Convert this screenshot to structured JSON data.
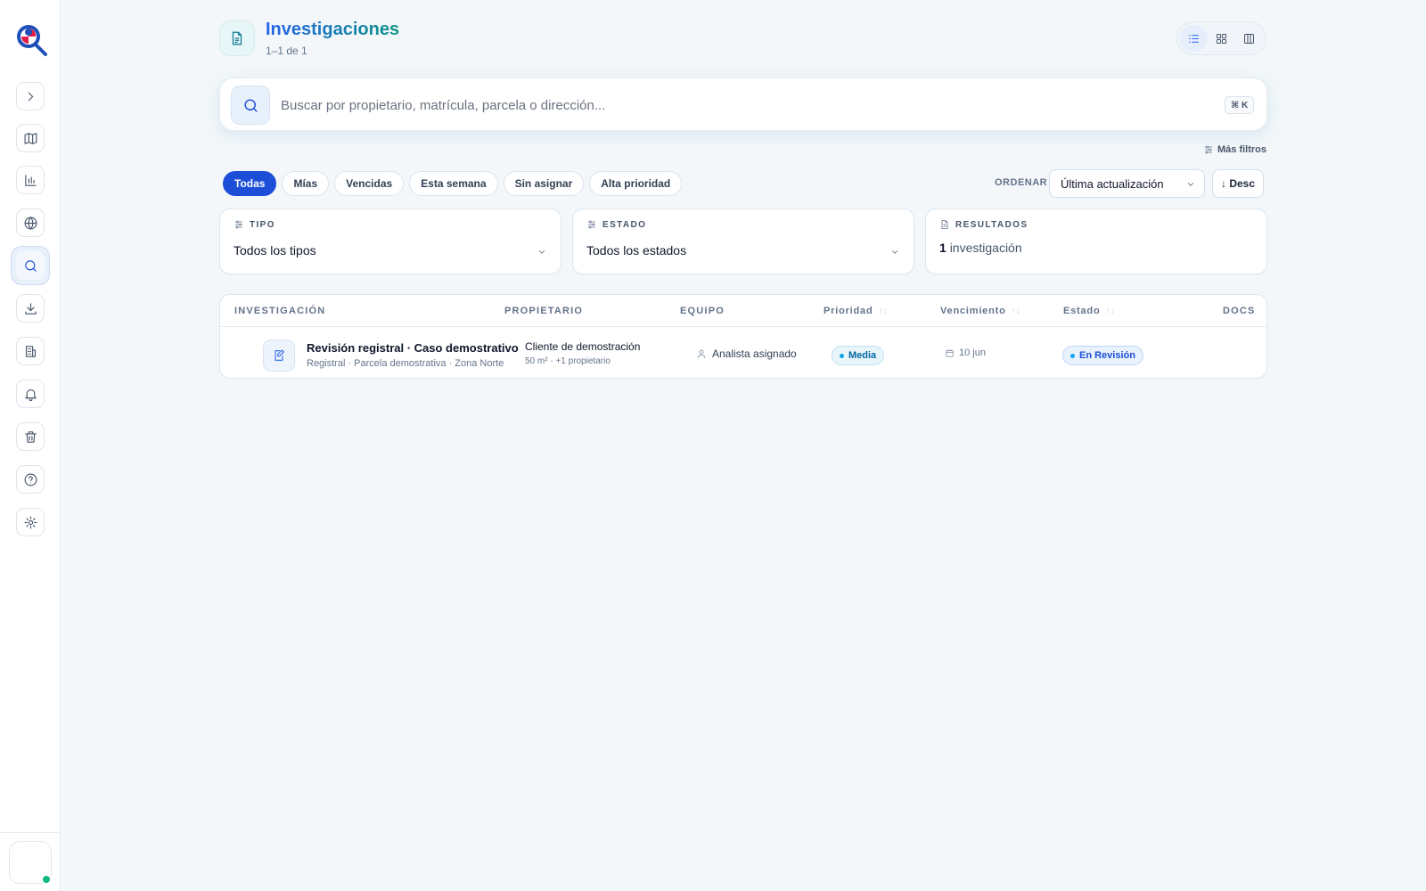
{
  "header": {
    "title": "Investigaciones",
    "range": "1–1 de 1"
  },
  "search": {
    "placeholder": "Buscar por propietario, matrícula, parcela o dirección...",
    "shortcut": "⌘ K"
  },
  "filters": {
    "more_label": "Más filtros",
    "chips": [
      "Todas",
      "Mías",
      "Vencidas",
      "Esta semana",
      "Sin asignar",
      "Alta prioridad"
    ],
    "active_chip": "Todas"
  },
  "sort": {
    "label": "ORDENAR",
    "selected": "Última actualización",
    "direction": "↓ Desc"
  },
  "cards": {
    "tipo": {
      "label": "TIPO",
      "value": "Todos los tipos"
    },
    "estado": {
      "label": "ESTADO",
      "value": "Todos los estados"
    },
    "resultados": {
      "label": "RESULTADOS",
      "count": "1",
      "unit": "investigación"
    }
  },
  "table": {
    "columns": {
      "investigacion": "INVESTIGACIÓN",
      "propietario": "PROPIETARIO",
      "equipo": "EQUIPO",
      "prioridad": "Prioridad",
      "vencimiento": "Vencimiento",
      "estado": "Estado",
      "docs": "DOCS"
    },
    "rows": [
      {
        "title": "Revisión registral · Caso demostrativo",
        "subtitle": "Registral · Parcela demostrativa · Zona Norte",
        "owner": "Cliente de demostración",
        "owner_detail": "50 m² · +1 propietario",
        "team": "Analista asignado",
        "priority": "Media",
        "due": "10 jun",
        "status": "En Revisión"
      }
    ]
  },
  "colors": {
    "accent": "#1d4ed8",
    "teal": "#0d9488",
    "online": "#10b981"
  },
  "sidebar_icons": [
    "chevron-right-icon",
    "map-icon",
    "bar-chart-icon",
    "globe-icon",
    "search-icon",
    "download-icon",
    "building-icon",
    "bell-icon",
    "trash-icon",
    "help-icon",
    "settings-icon"
  ]
}
